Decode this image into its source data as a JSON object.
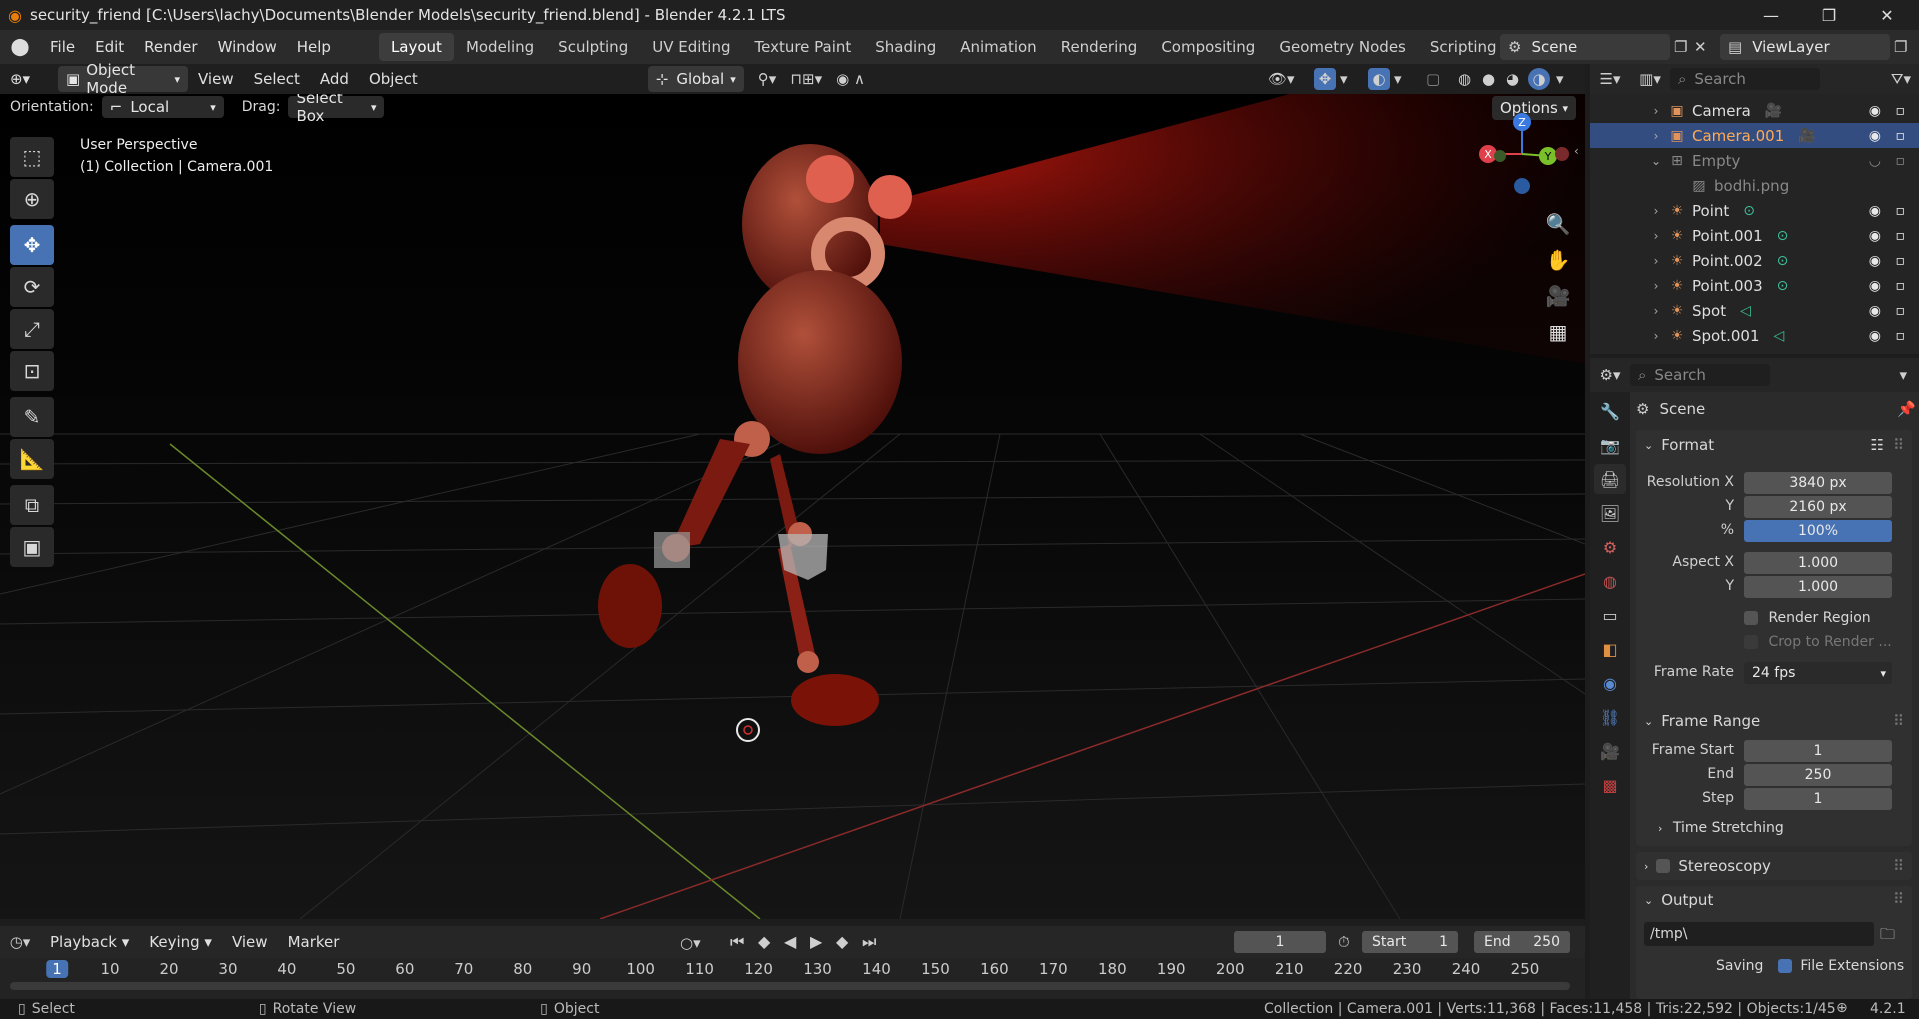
{
  "window": {
    "title": "security_friend [C:\\Users\\lachy\\Documents\\Blender Models\\security_friend.blend] - Blender 4.2.1 LTS"
  },
  "menu": [
    "File",
    "Edit",
    "Render",
    "Window",
    "Help"
  ],
  "workspaces": [
    "Layout",
    "Modeling",
    "Sculpting",
    "UV Editing",
    "Texture Paint",
    "Shading",
    "Animation",
    "Rendering",
    "Compositing",
    "Geometry Nodes",
    "Scripting"
  ],
  "scene": {
    "name": "Scene",
    "view_layer": "ViewLayer"
  },
  "viewport": {
    "mode": "Object Mode",
    "menus": [
      "View",
      "Select",
      "Add",
      "Object"
    ],
    "transform_orientation": "Global",
    "orientation_label": "Orientation:",
    "orientation_value": "Local",
    "drag_label": "Drag:",
    "drag_value": "Select Box",
    "options": "Options",
    "overlay_line1": "User Perspective",
    "overlay_line2": "(1) Collection | Camera.001",
    "gizmo": {
      "x": "X",
      "y": "Y",
      "z": "Z"
    }
  },
  "outliner": {
    "search_placeholder": "Search",
    "items": [
      {
        "name": "Camera",
        "icon": "camera-icon",
        "selected": false
      },
      {
        "name": "Camera.001",
        "icon": "camera-icon",
        "selected": true
      },
      {
        "name": "Empty",
        "icon": "empty-icon",
        "selected": false
      },
      {
        "name": "bodhi.png",
        "icon": "image-icon",
        "selected": false
      },
      {
        "name": "Point",
        "icon": "light-icon",
        "selected": false
      },
      {
        "name": "Point.001",
        "icon": "light-icon",
        "selected": false
      },
      {
        "name": "Point.002",
        "icon": "light-icon",
        "selected": false
      },
      {
        "name": "Point.003",
        "icon": "light-icon",
        "selected": false
      },
      {
        "name": "Spot",
        "icon": "light-icon",
        "selected": false
      },
      {
        "name": "Spot.001",
        "icon": "light-icon",
        "selected": false
      }
    ]
  },
  "properties": {
    "search_placeholder": "Search",
    "context": "Scene",
    "format": {
      "title": "Format",
      "res_x_label": "Resolution X",
      "res_x": "3840 px",
      "res_y_label": "Y",
      "res_y": "2160 px",
      "pct_label": "%",
      "pct": "100%",
      "aspect_x_label": "Aspect X",
      "aspect_x": "1.000",
      "aspect_y_label": "Y",
      "aspect_y": "1.000",
      "render_region": "Render Region",
      "crop": "Crop to Render ...",
      "frame_rate_label": "Frame Rate",
      "frame_rate": "24 fps"
    },
    "frame_range": {
      "title": "Frame Range",
      "start_label": "Frame Start",
      "start": "1",
      "end_label": "End",
      "end": "250",
      "step_label": "Step",
      "step": "1",
      "time_stretching": "Time Stretching"
    },
    "stereoscopy": "Stereoscopy",
    "output": {
      "title": "Output",
      "path": "/tmp\\",
      "saving_label": "Saving",
      "file_ext": "File Extensions"
    }
  },
  "timeline": {
    "menus": [
      "Playback",
      "Keying",
      "View",
      "Marker"
    ],
    "current_frame": "1",
    "start_label": "Start",
    "start": "1",
    "end_label": "End",
    "end": "250",
    "ticks": [
      "1",
      "10",
      "20",
      "30",
      "40",
      "50",
      "60",
      "70",
      "80",
      "90",
      "100",
      "110",
      "120",
      "130",
      "140",
      "150",
      "160",
      "170",
      "180",
      "190",
      "200",
      "210",
      "220",
      "230",
      "240",
      "250"
    ]
  },
  "statusbar": {
    "select": "Select",
    "rotate": "Rotate View",
    "object": "Object",
    "stats": "Collection | Camera.001 | Verts:11,368 | Faces:11,458 | Tris:22,592 | Objects:1/45",
    "version": "4.2.1"
  }
}
